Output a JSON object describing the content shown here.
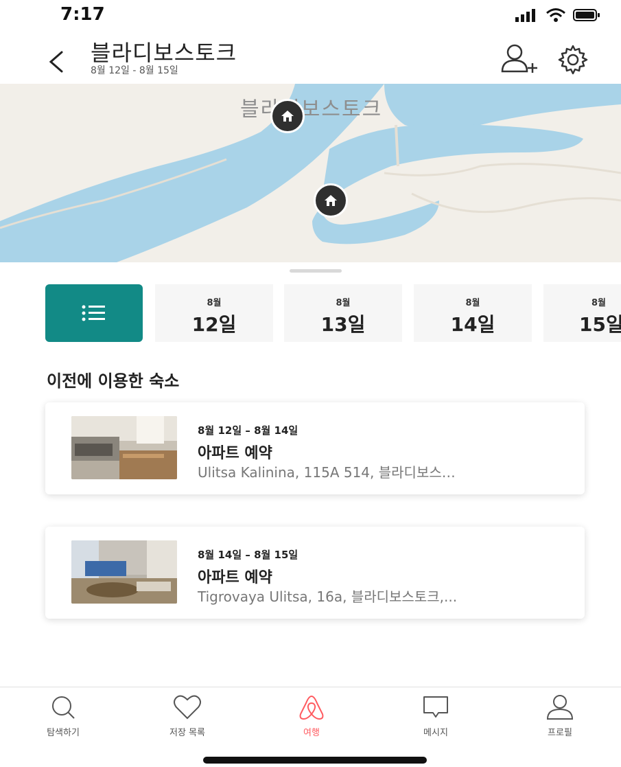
{
  "status_bar": {
    "time": "7:17"
  },
  "header": {
    "title": "블라디보스토크",
    "subtitle": "8월 12일 - 8월 15일"
  },
  "map": {
    "label": "블라디보스토크"
  },
  "date_strip": [
    {
      "month": "8월",
      "day": "12일"
    },
    {
      "month": "8월",
      "day": "13일"
    },
    {
      "month": "8월",
      "day": "14일"
    },
    {
      "month": "8월",
      "day": "15일"
    }
  ],
  "section_title": "이전에 이용한 숙소",
  "reservations": [
    {
      "dates": "8월 12일 – 8월 14일",
      "title": "아파트 예약",
      "address": "Ulitsa Kalinina, 115A 514, 블라디보스…"
    },
    {
      "dates": "8월 14일 – 8월 15일",
      "title": "아파트 예약",
      "address": "Tigrovaya Ulitsa, 16a, 블라디보스토크,..."
    }
  ],
  "bottom_nav": [
    {
      "label": "탐색하기",
      "icon": "search-icon"
    },
    {
      "label": "저장 목록",
      "icon": "heart-icon"
    },
    {
      "label": "여행",
      "icon": "airbnb-logo-icon",
      "active": true
    },
    {
      "label": "메시지",
      "icon": "message-icon"
    },
    {
      "label": "프로필",
      "icon": "profile-icon"
    }
  ],
  "colors": {
    "accent_teal": "#128a86",
    "active_tab": "#ff5a5f",
    "water": "#a9d3e8",
    "land": "#f2efe9"
  }
}
